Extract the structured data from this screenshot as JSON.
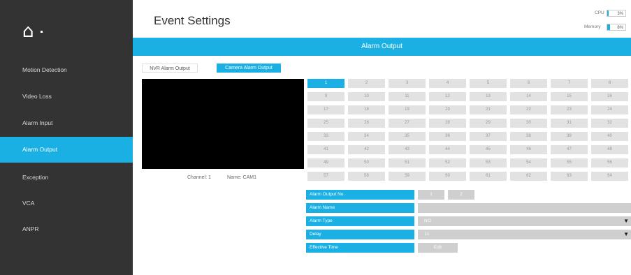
{
  "sidebar": {
    "logo_icon": "home-icon",
    "items": [
      {
        "label": "Motion Detection",
        "active": false
      },
      {
        "label": "Video Loss",
        "active": false
      },
      {
        "label": "Alarm Input",
        "active": false
      },
      {
        "label": "Alarm Output",
        "active": true
      },
      {
        "label": "Exception",
        "active": false
      },
      {
        "label": "VCA",
        "active": false
      },
      {
        "label": "ANPR",
        "active": false
      }
    ]
  },
  "header": {
    "title": "Event Settings",
    "cpu_label": "CPU",
    "cpu_value": "3%",
    "memory_label": "Memory",
    "memory_value": "8%"
  },
  "banner": {
    "title": "Alarm Output"
  },
  "tabs": {
    "nvr": "NVR Alarm Output",
    "camera": "Camera Alarm Output"
  },
  "preview": {
    "channel": "Channel: 1",
    "name": "Name: CAM1"
  },
  "channels": [
    "1",
    "2",
    "3",
    "4",
    "5",
    "6",
    "7",
    "8",
    "9",
    "10",
    "11",
    "12",
    "13",
    "14",
    "15",
    "16",
    "17",
    "18",
    "19",
    "20",
    "21",
    "22",
    "23",
    "24",
    "25",
    "26",
    "27",
    "28",
    "29",
    "30",
    "31",
    "32",
    "33",
    "34",
    "35",
    "36",
    "37",
    "38",
    "39",
    "40",
    "41",
    "42",
    "43",
    "44",
    "45",
    "46",
    "47",
    "48",
    "49",
    "50",
    "51",
    "52",
    "53",
    "54",
    "55",
    "56",
    "57",
    "58",
    "59",
    "60",
    "61",
    "62",
    "63",
    "64"
  ],
  "selected_channel": "1",
  "form": {
    "output_no_label": "Alarm Output No.",
    "output_no_values": [
      "1",
      "2"
    ],
    "name_label": "Alarm Name",
    "name_value": "",
    "type_label": "Alarm Type",
    "type_value": "NO",
    "delay_label": "Delay",
    "delay_value": "1s",
    "effective_label": "Effective Time",
    "edit_label": "Edit"
  },
  "colors": {
    "accent": "#1ab0e4",
    "sidebar": "#333333"
  }
}
